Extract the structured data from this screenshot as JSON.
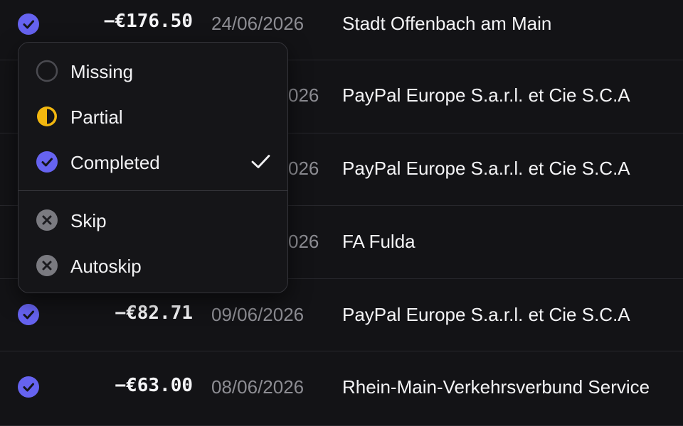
{
  "colors": {
    "background": "#131316",
    "completed": "#6663f0",
    "partial": "#f2b70f",
    "skip": "#7a7a80",
    "date_text": "#8d8d93"
  },
  "transactions": [
    {
      "status": "completed",
      "status_icon": "check-circle-icon",
      "amount": "−€176.50",
      "date": "24/06/2026",
      "payee": "Stadt Offenbach am Main"
    },
    {
      "status": "completed",
      "status_icon": "check-circle-icon",
      "amount": "",
      "date": "026",
      "payee": "PayPal Europe S.a.r.l. et Cie S.C.A"
    },
    {
      "status": "completed",
      "status_icon": "check-circle-icon",
      "amount": "",
      "date": "026",
      "payee": "PayPal Europe S.a.r.l. et Cie S.C.A"
    },
    {
      "status": "completed",
      "status_icon": "check-circle-icon",
      "amount": "",
      "date": "026",
      "payee": "FA Fulda"
    },
    {
      "status": "completed",
      "status_icon": "check-circle-icon",
      "amount": "−€82.71",
      "date": "09/06/2026",
      "payee": "PayPal Europe S.a.r.l. et Cie S.C.A"
    },
    {
      "status": "completed",
      "status_icon": "check-circle-icon",
      "amount": "−€63.00",
      "date": "08/06/2026",
      "payee": "Rhein-Main-Verkehrsverbund Service"
    }
  ],
  "status_menu": {
    "selected": "Completed",
    "items": [
      {
        "label": "Missing",
        "icon": "empty-circle-icon"
      },
      {
        "label": "Partial",
        "icon": "half-circle-icon"
      },
      {
        "label": "Completed",
        "icon": "check-circle-icon",
        "selected_icon": "checkmark-icon"
      },
      {
        "label": "Skip",
        "icon": "x-circle-icon"
      },
      {
        "label": "Autoskip",
        "icon": "x-circle-icon"
      }
    ]
  }
}
